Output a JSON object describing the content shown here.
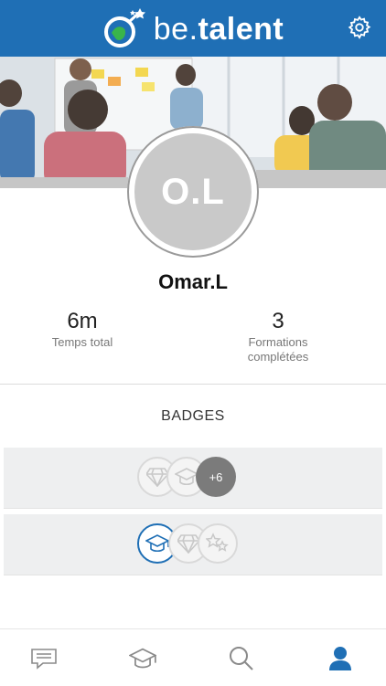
{
  "header": {
    "logo_prefix": "be.",
    "logo_suffix": "talent",
    "brand_color": "#1f6fb5",
    "settings_icon": "gear-icon"
  },
  "banner": {
    "image": "team-meeting-photo"
  },
  "profile": {
    "initials": "O.L",
    "name": "Omar.L"
  },
  "stats": [
    {
      "value": "6m",
      "label_lines": [
        "Temps total"
      ]
    },
    {
      "value": "3",
      "label_lines": [
        "Formations",
        "complétées"
      ]
    }
  ],
  "badges": {
    "title": "BADGES",
    "rows": [
      {
        "icons": [
          "diamond-icon",
          "graduation-cap-icon"
        ],
        "more": "+6"
      },
      {
        "icons": [
          "graduation-cap-icon",
          "diamond-icon",
          "stars-icon"
        ],
        "active_index": 0
      }
    ]
  },
  "bottom_nav": [
    {
      "icon": "message-icon",
      "active": false
    },
    {
      "icon": "graduation-cap-icon",
      "active": false
    },
    {
      "icon": "search-icon",
      "active": false
    },
    {
      "icon": "user-icon",
      "active": true
    }
  ],
  "colors": {
    "active_nav": "#1f6fb5",
    "inactive_nav": "#8a8a8a",
    "badge_row_bg": "#eeeff0"
  }
}
